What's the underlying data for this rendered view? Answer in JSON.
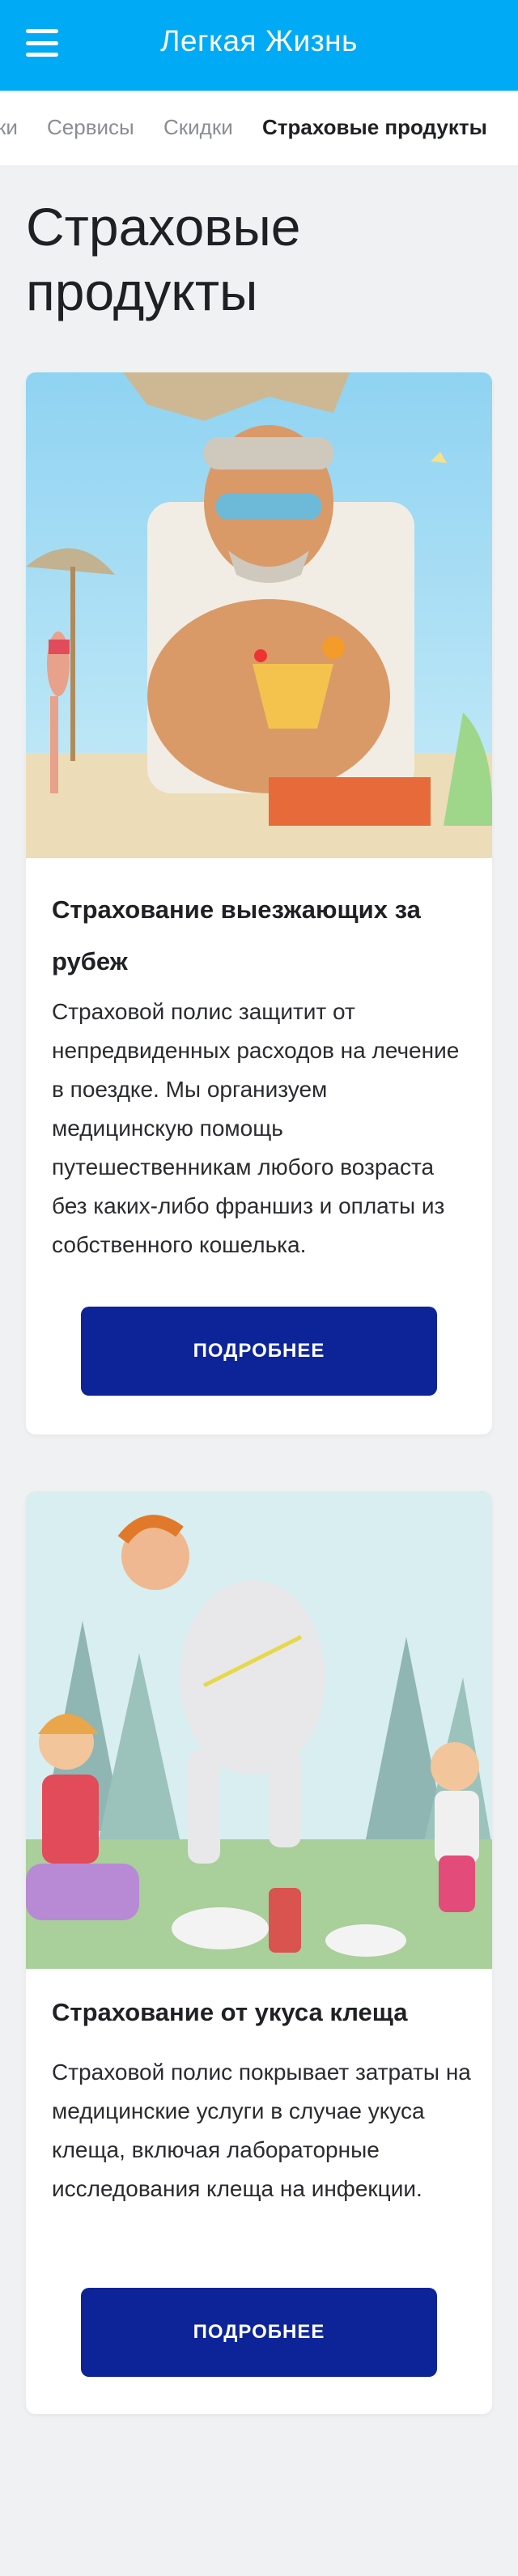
{
  "appbar": {
    "title": "Легкая Жизнь",
    "menu_icon": "hamburger-menu-icon",
    "background": "#00aaf5"
  },
  "tabs": {
    "items": [
      {
        "label": "ки",
        "active": false
      },
      {
        "label": "Сервисы",
        "active": false
      },
      {
        "label": "Скидки",
        "active": false
      },
      {
        "label": "Страховые продукты",
        "active": true
      }
    ]
  },
  "page": {
    "title": "Страховые продукты"
  },
  "cards": [
    {
      "image": "vacation-beach-illustration",
      "title": "Страхование выезжающих за рубеж",
      "text": "Страховой полис защитит от непредвиденных расходов на лечение в поездке. Мы организуем медицинскую помощь путешественникам любого возраста без каких-либо франшиз и оплаты из собственного кошелька.",
      "button": "ПОДРОБНЕЕ"
    },
    {
      "image": "picnic-forest-illustration",
      "title": "Страхование от укуса клеща",
      "text": "Страховой полис покрывает затраты на медицинские услуги в случае укуса клеща, включая лабораторные исследования клеща на инфекции.",
      "button": "ПОДРОБНЕЕ"
    }
  ],
  "colors": {
    "accent": "#00aaf5",
    "button": "#0d2499",
    "background": "#f0f1f3"
  }
}
